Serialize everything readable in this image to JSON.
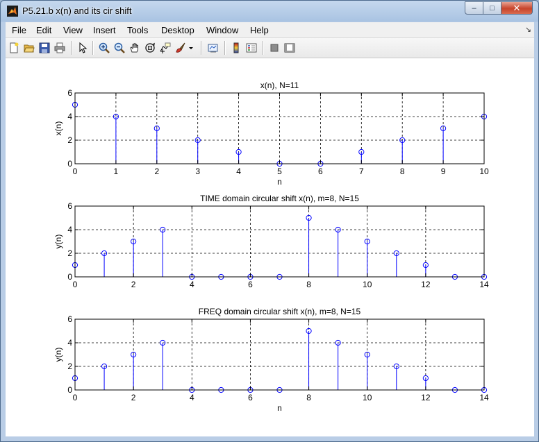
{
  "window": {
    "title": "P5.21.b x(n) and its cir shift",
    "minimize": "–",
    "maximize": "□",
    "close": "✕"
  },
  "menu": {
    "items": [
      "File",
      "Edit",
      "View",
      "Insert",
      "Tools",
      "Desktop",
      "Window",
      "Help"
    ],
    "dock_glyph": "↘"
  },
  "toolbar": {
    "icons": [
      "new-figure-icon",
      "open-file-icon",
      "save-icon",
      "print-icon",
      "pointer-icon",
      "zoom-in-icon",
      "zoom-out-icon",
      "pan-hand-icon",
      "rotate-3d-icon",
      "data-cursor-icon",
      "brush-icon",
      "brush-dropdown-icon",
      "link-plot-icon",
      "colorbar-icon",
      "legend-icon",
      "hide-plot-tools-icon",
      "show-plot-tools-icon"
    ]
  },
  "colors": {
    "stem": "#0000ff",
    "axes": "#000000",
    "grid": "#000000"
  },
  "chart_data": [
    {
      "type": "stem",
      "title": "x(n), N=11",
      "xlabel": "n",
      "ylabel": "x(n)",
      "xlim": [
        0,
        10
      ],
      "ylim": [
        0,
        6
      ],
      "xticks": [
        0,
        1,
        2,
        3,
        4,
        5,
        6,
        7,
        8,
        9,
        10
      ],
      "yticks": [
        0,
        2,
        4,
        6
      ],
      "grid": true,
      "x": [
        0,
        1,
        2,
        3,
        4,
        5,
        6,
        7,
        8,
        9,
        10
      ],
      "values": [
        5,
        4,
        3,
        2,
        1,
        0,
        0,
        1,
        2,
        3,
        4
      ]
    },
    {
      "type": "stem",
      "title": "TIME domain circular shift x(n), m=8, N=15",
      "xlabel": "",
      "ylabel": "y(n)",
      "xlim": [
        0,
        14
      ],
      "ylim": [
        0,
        6
      ],
      "xticks": [
        0,
        2,
        4,
        6,
        8,
        10,
        12,
        14
      ],
      "yticks": [
        0,
        2,
        4,
        6
      ],
      "grid": true,
      "x": [
        0,
        1,
        2,
        3,
        4,
        5,
        6,
        7,
        8,
        9,
        10,
        11,
        12,
        13,
        14
      ],
      "values": [
        1,
        2,
        3,
        4,
        0,
        0,
        0,
        0,
        5,
        4,
        3,
        2,
        1,
        0,
        0
      ]
    },
    {
      "type": "stem",
      "title": "FREQ domain circular shift x(n), m=8, N=15",
      "xlabel": "n",
      "ylabel": "y(n)",
      "xlim": [
        0,
        14
      ],
      "ylim": [
        0,
        6
      ],
      "xticks": [
        0,
        2,
        4,
        6,
        8,
        10,
        12,
        14
      ],
      "yticks": [
        0,
        2,
        4,
        6
      ],
      "grid": true,
      "x": [
        0,
        1,
        2,
        3,
        4,
        5,
        6,
        7,
        8,
        9,
        10,
        11,
        12,
        13,
        14
      ],
      "values": [
        1,
        2,
        3,
        4,
        0,
        0,
        0,
        0,
        5,
        4,
        3,
        2,
        1,
        0,
        0
      ]
    }
  ]
}
